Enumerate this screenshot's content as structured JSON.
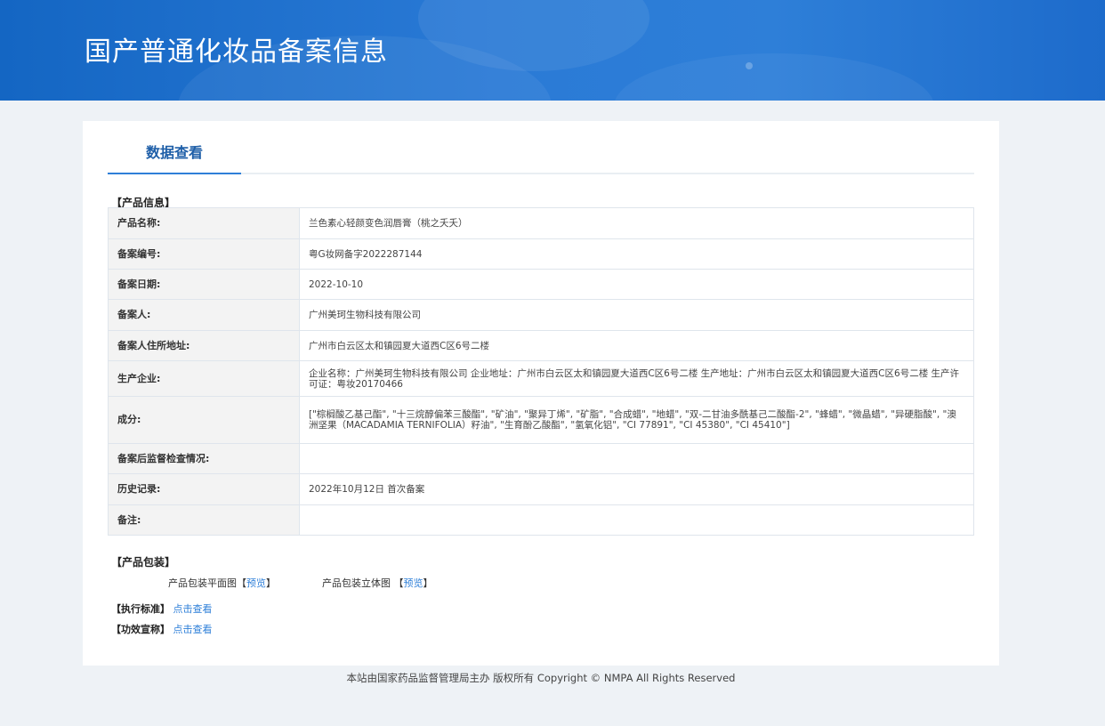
{
  "header": {
    "title": "国产普通化妆品备案信息"
  },
  "tab": {
    "label": "数据查看"
  },
  "sections": {
    "product_info": "【产品信息】",
    "packaging": "【产品包装】",
    "standard": "【执行标准】",
    "efficacy": "【功效宣称】"
  },
  "table": {
    "rows": [
      {
        "key": "产品名称:",
        "value": "兰色素心轻颜变色润唇膏（桃之夭夭）"
      },
      {
        "key": "备案编号:",
        "value": "粤G妆网备字2022287144"
      },
      {
        "key": "备案日期:",
        "value": "2022-10-10"
      },
      {
        "key": "备案人:",
        "value": "广州美珂生物科技有限公司"
      },
      {
        "key": "备案人住所地址:",
        "value": "广州市白云区太和镇园夏大道西C区6号二楼"
      },
      {
        "key": "生产企业:",
        "value": "企业名称：广州美珂生物科技有限公司 企业地址：广州市白云区太和镇园夏大道西C区6号二楼 生产地址：广州市白云区太和镇园夏大道西C区6号二楼 生产许可证：粤妆20170466"
      },
      {
        "key": "成分:",
        "value": "[\"棕榈酸乙基己酯\", \"十三烷醇偏苯三酸酯\", \"矿油\", \"聚异丁烯\", \"矿脂\", \"合成蜡\", \"地蜡\", \"双-二甘油多酰基己二酸酯-2\", \"蜂蜡\", \"微晶蜡\", \"异硬脂酸\", \"澳洲坚果（MACADAMIA TERNIFOLIA）籽油\", \"生育酚乙酸酯\", \"氢氧化铝\", \"CI 77891\", \"CI 45380\", \"CI 45410\"]"
      },
      {
        "key": "备案后监督检查情况:",
        "value": ""
      },
      {
        "key": "历史记录:",
        "value": "2022年10月12日 首次备案"
      },
      {
        "key": "备注:",
        "value": ""
      }
    ]
  },
  "packaging": {
    "flat_label": "产品包装平面图",
    "flat_preview": "预览",
    "solid_label": "产品包装立体图",
    "solid_preview": "预览",
    "bracket_open": "【",
    "bracket_close": "】"
  },
  "links": {
    "standard_link": "点击查看",
    "efficacy_link": "点击查看"
  },
  "footer": {
    "text": "本站由国家药品监督管理局主办 版权所有 Copyright © NMPA All Rights Reserved"
  }
}
